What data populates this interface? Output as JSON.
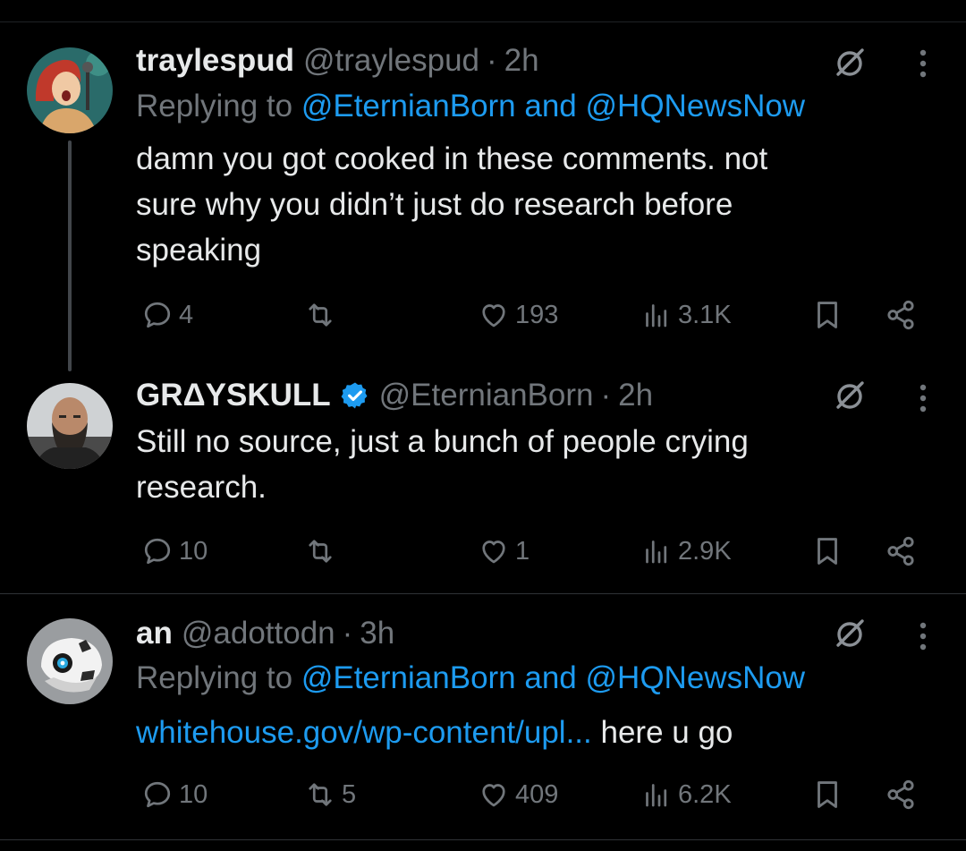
{
  "colors": {
    "background": "#000000",
    "primary_text": "#e7e9ea",
    "secondary_text": "#71767b",
    "link": "#1d9bf0",
    "divider": "#2f3336"
  },
  "tweets": [
    {
      "name": "traylespud",
      "handle": "@traylespud",
      "dot": "·",
      "time": "2h",
      "replying_prefix": "Replying to ",
      "reply_to_1": "@EternianBorn",
      "reply_and": " and ",
      "reply_to_2": "@HQNewsNow",
      "lines": [
        "damn you got cooked in these comments. not",
        "sure why you didn’t just do research before",
        "speaking"
      ],
      "replies": "4",
      "reposts": "",
      "likes": "193",
      "views": "3.1K",
      "avatar_icon": "avatar-singer-icon"
    },
    {
      "name": "GRΔYSKULL",
      "handle": "@EternianBorn",
      "dot": "·",
      "time": "2h",
      "verified": true,
      "lines": [
        "Still no source, just a bunch of people crying",
        "research."
      ],
      "replies": "10",
      "reposts": "",
      "likes": "1",
      "views": "2.9K",
      "avatar_icon": "avatar-bearded-man-icon"
    },
    {
      "name": "an",
      "handle": "@adottodn",
      "dot": "·",
      "time": "3h",
      "replying_prefix": "Replying to ",
      "reply_to_1": "@EternianBorn",
      "reply_and": " and ",
      "reply_to_2": "@HQNewsNow",
      "link_text": "whitehouse.gov/wp-content/upl...",
      "after_link": " here u go",
      "replies": "10",
      "reposts": "5",
      "likes": "409",
      "views": "6.2K",
      "avatar_icon": "avatar-robot-icon"
    }
  ]
}
